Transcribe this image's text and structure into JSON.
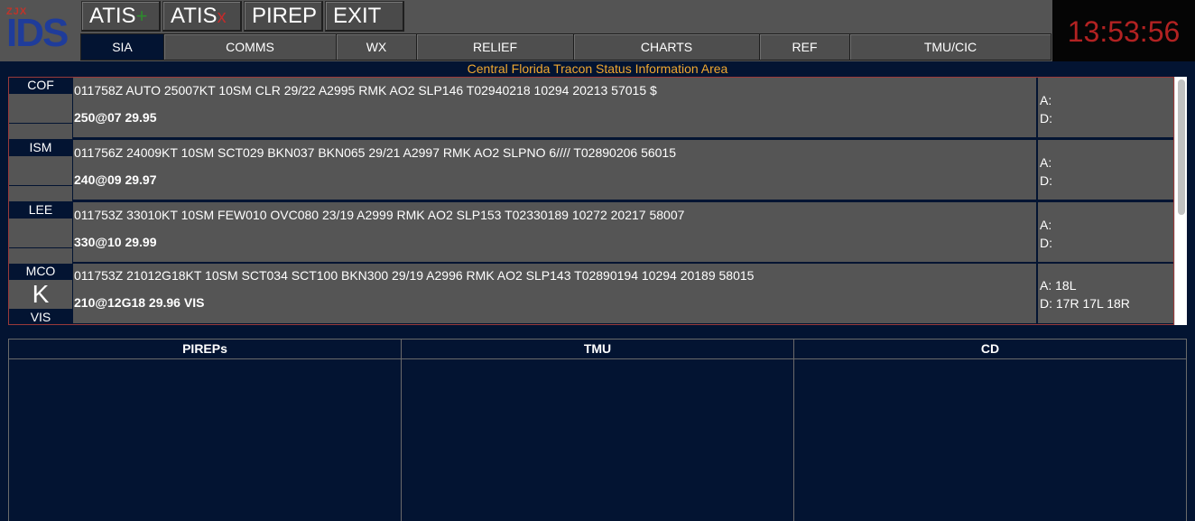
{
  "logo": {
    "small": "ZJX",
    "big": "IDS"
  },
  "toolbar": {
    "atis_add_label": "ATIS",
    "atis_add_mark": "+",
    "atis_delete_label": "ATIS",
    "atis_delete_mark": "x",
    "pirep_label": "PIREP",
    "exit_label": "EXIT"
  },
  "tabs": [
    {
      "label": "SIA",
      "active": true
    },
    {
      "label": "COMMS"
    },
    {
      "label": "WX"
    },
    {
      "label": "RELIEF"
    },
    {
      "label": "CHARTS"
    },
    {
      "label": "REF"
    },
    {
      "label": "TMU/CIC"
    }
  ],
  "clock": "13:53:56",
  "sia_title": "Central Florida Tracon Status Information Area",
  "airports": [
    {
      "code": "COF",
      "atis": "",
      "foot": "",
      "metar": "011758Z AUTO 25007KT 10SM CLR 29/22 A2995 RMK AO2 SLP146 T02940218 10294 20213 57015 $",
      "wind": "250@07 29.95",
      "arrival": "A:",
      "departure": "D:"
    },
    {
      "code": "ISM",
      "atis": "",
      "foot": "",
      "metar": "011756Z 24009KT 10SM SCT029 BKN037 BKN065 29/21 A2997 RMK AO2 SLPNO 6//// T02890206 56015",
      "wind": "240@09 29.97",
      "arrival": "A:",
      "departure": "D:"
    },
    {
      "code": "LEE",
      "atis": "",
      "foot": "",
      "metar": "011753Z 33010KT 10SM FEW010 OVC080 23/19 A2999 RMK AO2 SLP153 T02330189 10272 20217 58007",
      "wind": "330@10 29.99",
      "arrival": "A:",
      "departure": "D:"
    },
    {
      "code": "MCO",
      "atis": "K",
      "foot": "VIS",
      "metar": "011753Z 21012G18KT 10SM SCT034 SCT100 BKN300 29/19 A2996 RMK AO2 SLP143 T02890194 10294 20189 58015",
      "wind": "210@12G18 29.96 VIS",
      "arrival": "A: 18L",
      "departure": "D: 17R 17L 18R"
    }
  ],
  "panels": [
    {
      "title": "PIREPs"
    },
    {
      "title": "TMU"
    },
    {
      "title": "CD"
    }
  ],
  "colors": {
    "background": "#031432",
    "panel_gray": "#555555",
    "title_amber": "#f0a830",
    "clock_red": "#b22222"
  }
}
